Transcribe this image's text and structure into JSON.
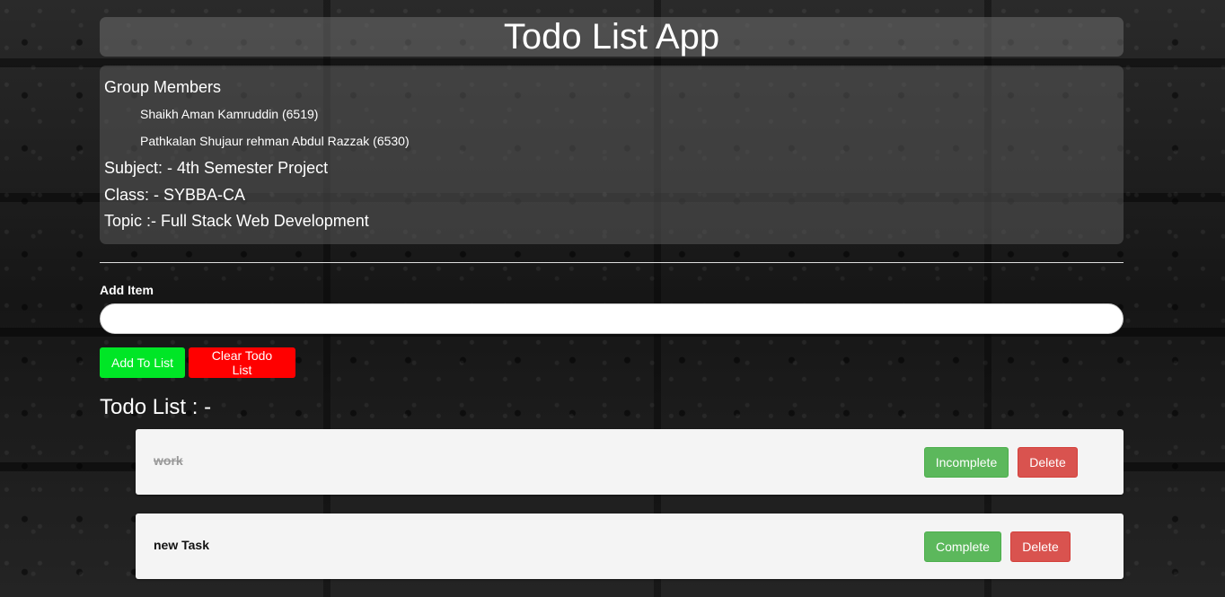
{
  "header": {
    "title": "Todo List App"
  },
  "info": {
    "group_heading": "Group Members",
    "members": [
      "Shaikh Aman Kamruddin (6519)",
      "Pathkalan Shujaur rehman Abdul Razzak (6530)"
    ],
    "subject": "Subject: - 4th Semester Project",
    "class": "Class: - SYBBA-CA",
    "topic": "Topic :- Full Stack Web Development"
  },
  "form": {
    "add_label": "Add Item",
    "input_value": "",
    "add_button": "Add To List",
    "clear_button": "Clear Todo List"
  },
  "list": {
    "heading": "Todo List : -",
    "items": [
      {
        "text": "work",
        "completed": true,
        "toggle_label": "Incomplete",
        "delete_label": "Delete"
      },
      {
        "text": "new Task",
        "completed": false,
        "toggle_label": "Complete",
        "delete_label": "Delete"
      }
    ]
  },
  "colors": {
    "add_button": "#00e626",
    "clear_button": "#ff0000",
    "toggle_button": "#5cb85c",
    "delete_button": "#d9534f"
  }
}
